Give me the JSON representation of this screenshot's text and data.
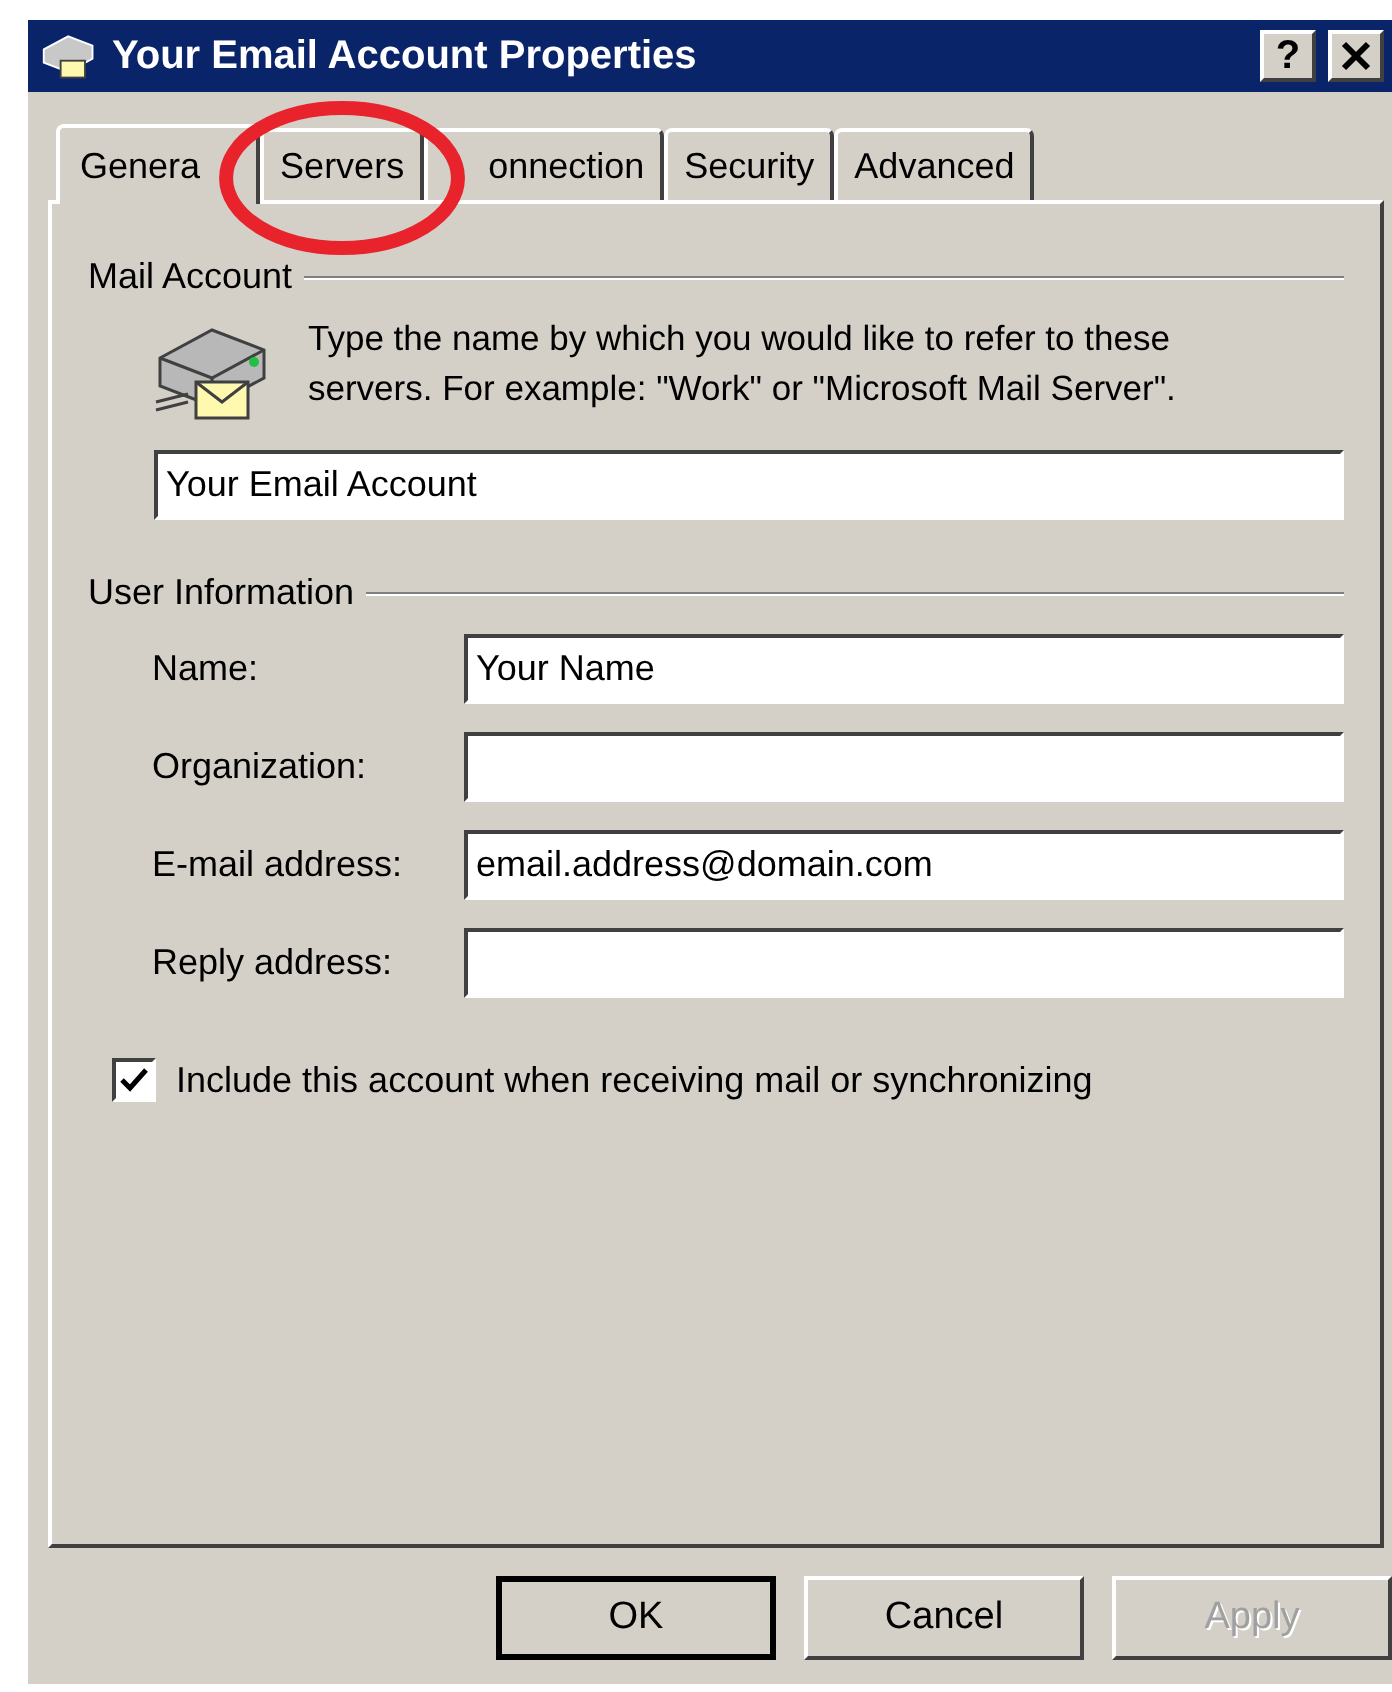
{
  "window": {
    "title": "Your Email Account Properties",
    "help_button": "?"
  },
  "tabs": [
    {
      "label": "Genera",
      "selected": true,
      "circled": false
    },
    {
      "label": "Servers",
      "selected": false,
      "circled": true
    },
    {
      "label": "onnection",
      "selected": false,
      "circled": false
    },
    {
      "label": "Security",
      "selected": false,
      "circled": false
    },
    {
      "label": "Advanced",
      "selected": false,
      "circled": false
    }
  ],
  "mail_account": {
    "heading": "Mail Account",
    "description": "Type the name by which you would like to refer to these servers.  For example: \"Work\" or \"Microsoft Mail Server\".",
    "account_name": "Your Email Account"
  },
  "user_information": {
    "heading": "User Information",
    "fields": [
      {
        "label": "Name:",
        "value": "Your Name"
      },
      {
        "label": "Organization:"
      },
      {
        "label": "E-mail address:",
        "value": "email.address@domain.com"
      },
      {
        "label": "Reply address:"
      }
    ]
  },
  "include_account": {
    "label": "Include this account when receiving mail or synchronizing",
    "checked": true
  },
  "buttons": [
    {
      "label": "OK",
      "default": true,
      "disabled": false
    },
    {
      "label": "Cancel",
      "default": false,
      "disabled": false
    },
    {
      "label": "Apply",
      "default": false,
      "disabled": true
    }
  ]
}
